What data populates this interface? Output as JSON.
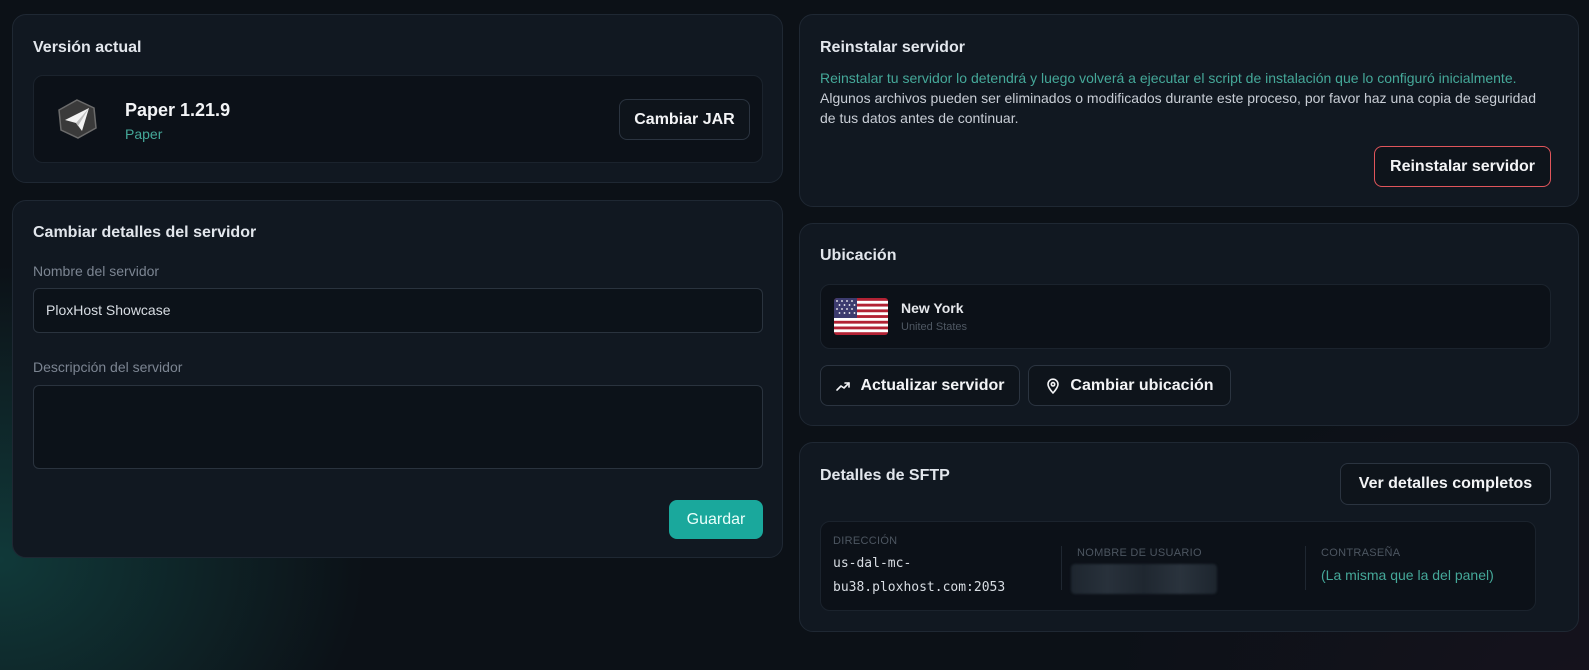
{
  "version": {
    "title": "Versión actual",
    "name": "Paper 1.21.9",
    "type": "Paper",
    "icon": "paper-plane-logo-icon",
    "change_jar_label": "Cambiar JAR"
  },
  "details": {
    "title": "Cambiar detalles del servidor",
    "name_label": "Nombre del servidor",
    "name_value": "PloxHost Showcase",
    "description_label": "Descripción del servidor",
    "description_value": "",
    "save_label": "Guardar"
  },
  "reinstall": {
    "title": "Reinstalar servidor",
    "warning_highlight": "Reinstalar tu servidor lo detendrá y luego volverá a ejecutar el script de instalación que lo configuró inicialmente.",
    "warning_rest": " Algunos archivos pueden ser eliminados o modificados durante este proceso, por favor haz una copia de seguridad de tus datos antes de continuar.",
    "button_label": "Reinstalar servidor"
  },
  "location": {
    "title": "Ubicación",
    "city": "New York",
    "country": "United States",
    "flag_icon": "us-flag-icon",
    "update_label": "Actualizar servidor",
    "change_label": "Cambiar ubicación"
  },
  "sftp": {
    "title": "Detalles de SFTP",
    "view_full_label": "Ver detalles completos",
    "address_label": "DIRECCIÓN",
    "address_line1": "us-dal-mc-",
    "address_line2": "bu38.ploxhost.com:2053",
    "username_label": "NOMBRE DE USUARIO",
    "password_label": "CONTRASEÑA",
    "password_value": "(La misma que la del panel)"
  },
  "colors": {
    "accent": "#1aa89c",
    "danger_border": "#e0555b",
    "muted_teal": "#45a899"
  }
}
